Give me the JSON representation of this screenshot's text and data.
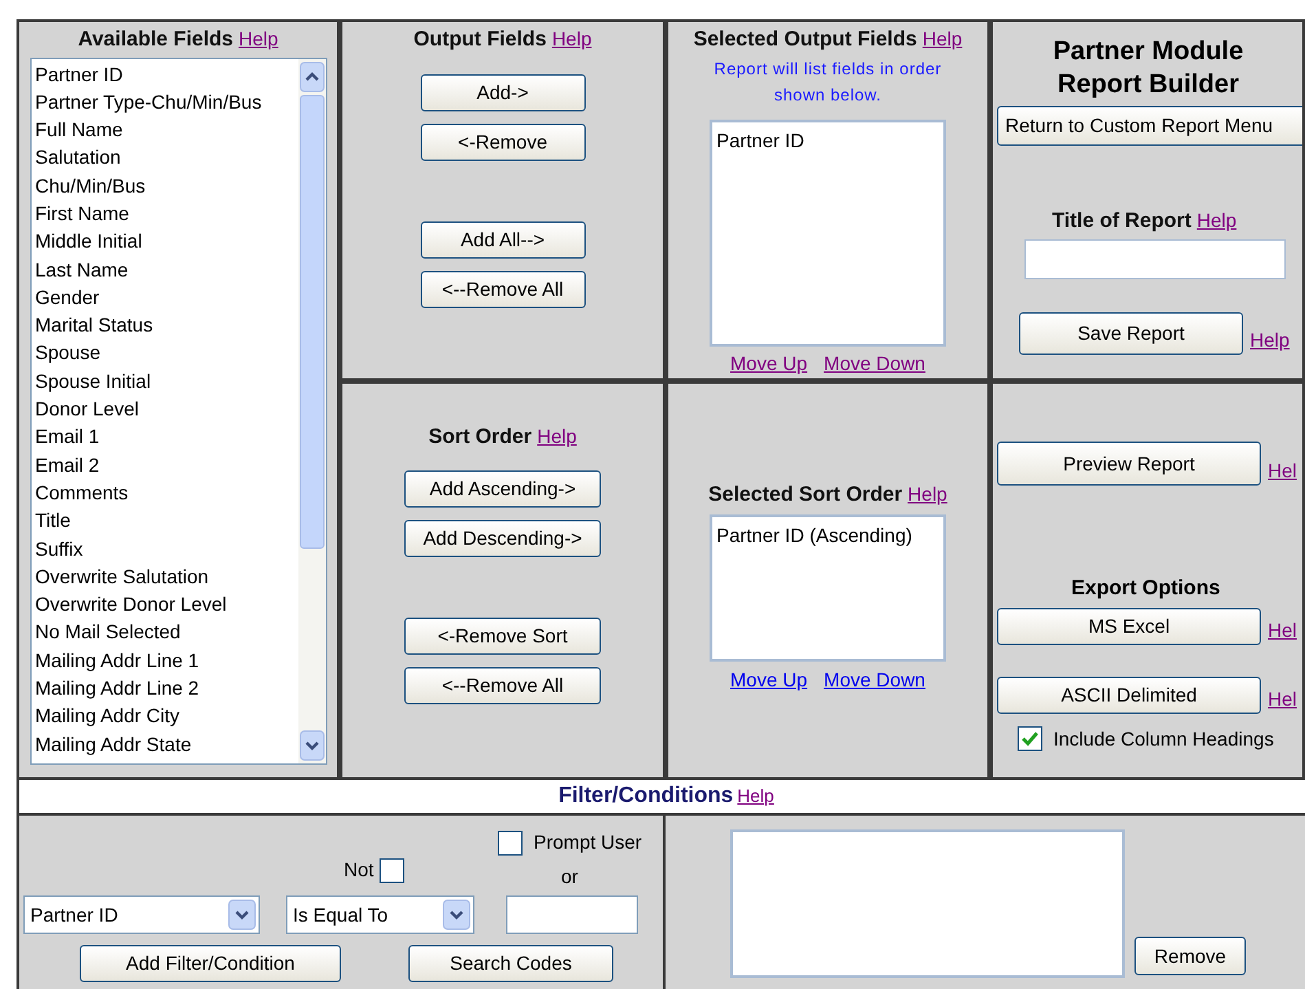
{
  "available_fields": {
    "title": "Available Fields",
    "help": {
      "label": "Help",
      "visited": true
    },
    "items": [
      "Partner ID",
      "Partner Type-Chu/Min/Bus",
      "Full Name",
      "Salutation",
      "Chu/Min/Bus",
      "First Name",
      "Middle Initial",
      "Last Name",
      "Gender",
      "Marital Status",
      "Spouse",
      "Spouse Initial",
      "Donor Level",
      "Email 1",
      "Email 2",
      "Comments",
      "Title",
      "Suffix",
      "Overwrite Salutation",
      "Overwrite Donor Level",
      "No Mail Selected",
      "Mailing Addr Line 1",
      "Mailing Addr Line 2",
      "Mailing Addr City",
      "Mailing Addr State"
    ]
  },
  "output_fields": {
    "title": "Output Fields",
    "help": {
      "label": "Help",
      "visited": true
    },
    "buttons": [
      "Add->",
      "<-Remove",
      "Add All-->",
      "<--Remove All"
    ]
  },
  "selected_output_fields": {
    "title": "Selected Output Fields",
    "help": {
      "label": "Help",
      "visited": true
    },
    "note": "Report will list fields in order shown below.",
    "items": [
      "Partner ID"
    ],
    "links": [
      {
        "label": "Move Up",
        "visited": true
      },
      {
        "label": "Move Down",
        "visited": true
      }
    ]
  },
  "report_builder": {
    "heading": [
      "Partner Module",
      "Report Builder"
    ],
    "return_button": "Return to Custom Report Menu",
    "title_label": "Title of Report",
    "title_help": {
      "label": "Help",
      "visited": true
    },
    "save_button": "Save Report",
    "save_help": {
      "label": "Help",
      "visited": true
    }
  },
  "sort_order": {
    "title": "Sort Order",
    "help": {
      "label": "Help",
      "visited": true
    },
    "buttons": [
      "Add Ascending->",
      "Add Descending->",
      "<-Remove Sort",
      "<--Remove All"
    ]
  },
  "selected_sort_order": {
    "title": "Selected Sort Order",
    "help": {
      "label": "Help",
      "visited": true
    },
    "items": [
      "Partner ID (Ascending)"
    ],
    "links": [
      {
        "label": "Move Up",
        "visited": false
      },
      {
        "label": "Move Down",
        "visited": false
      }
    ]
  },
  "report_actions": {
    "preview_button": "Preview Report",
    "preview_help": {
      "label": "Hel",
      "visited": true
    },
    "export_title": "Export Options",
    "export_buttons": [
      {
        "label": "MS Excel",
        "help": {
          "label": "Hel",
          "visited": true
        }
      },
      {
        "label": "ASCII Delimited",
        "help": {
          "label": "Hel",
          "visited": true
        }
      }
    ],
    "column_headings": {
      "label": "Include Column Headings",
      "checked": true
    }
  },
  "filter": {
    "title": "Filter/Conditions",
    "help": {
      "label": "Help",
      "visited": true
    },
    "prompt_user": {
      "label": "Prompt User",
      "checked": false
    },
    "or_label": "or",
    "not": {
      "label": "Not",
      "checked": false
    },
    "field_select": "Partner ID",
    "operator_select": "Is Equal To",
    "add_button": "Add Filter/Condition",
    "search_button": "Search Codes",
    "remove_button": "Remove"
  }
}
